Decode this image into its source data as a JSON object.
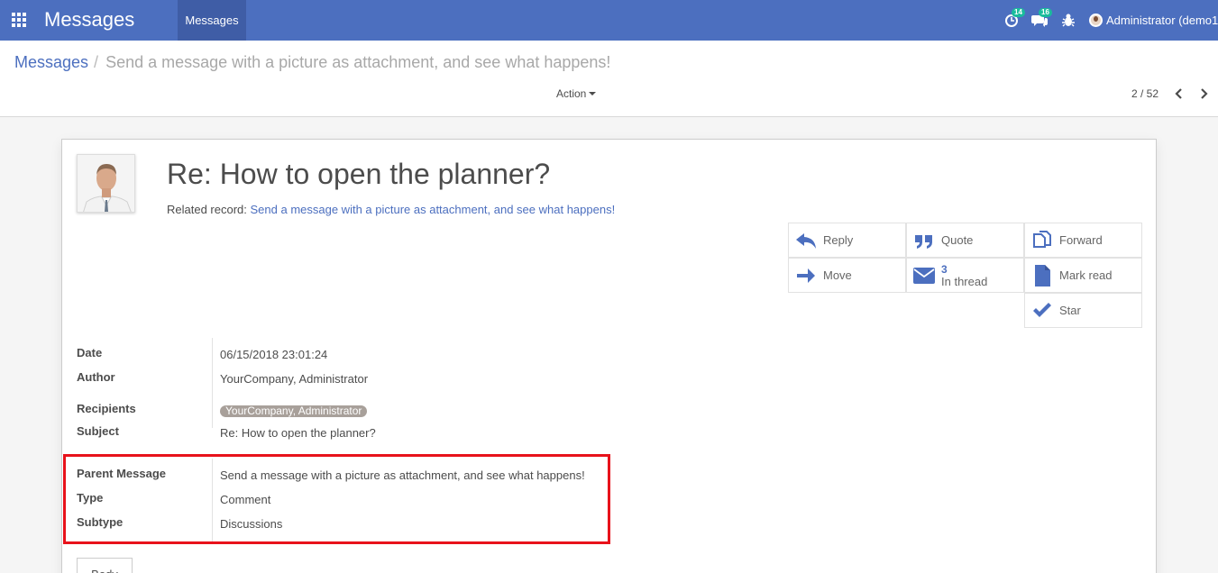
{
  "topbar": {
    "app_title": "Messages",
    "menu": "Messages",
    "activity_badge": "14",
    "chat_badge": "16",
    "user": "Administrator (demo1",
    "bg_color": "#4c6fbf"
  },
  "breadcrumb": {
    "root": "Messages",
    "separator": "/",
    "current": "Send a message with a picture as attachment, and see what happens!"
  },
  "control": {
    "action": "Action",
    "pager": "2 / 52"
  },
  "record": {
    "title": "Re: How to open the planner?",
    "related_label": "Related record: ",
    "related_value": "Send a message with a picture as attachment, and see what happens!"
  },
  "buttons": {
    "reply": "Reply",
    "quote": "Quote",
    "forward": "Forward",
    "move": "Move",
    "thread_count": "3",
    "thread_label": "In thread",
    "mark_read": "Mark read",
    "star": "Star"
  },
  "fields": {
    "date_label": "Date",
    "date_value": "06/15/2018 23:01:24",
    "author_label": "Author",
    "author_value": "YourCompany, Administrator",
    "recipients_label": "Recipients",
    "recipients_tag": "YourCompany, Administrator",
    "subject_label": "Subject",
    "subject_value": "Re: How to open the planner?",
    "parent_label": "Parent Message",
    "parent_value": "Send a message with a picture as attachment, and see what happens!",
    "type_label": "Type",
    "type_value": "Comment",
    "subtype_label": "Subtype",
    "subtype_value": "Discussions"
  },
  "tabs": {
    "body": "Body"
  }
}
